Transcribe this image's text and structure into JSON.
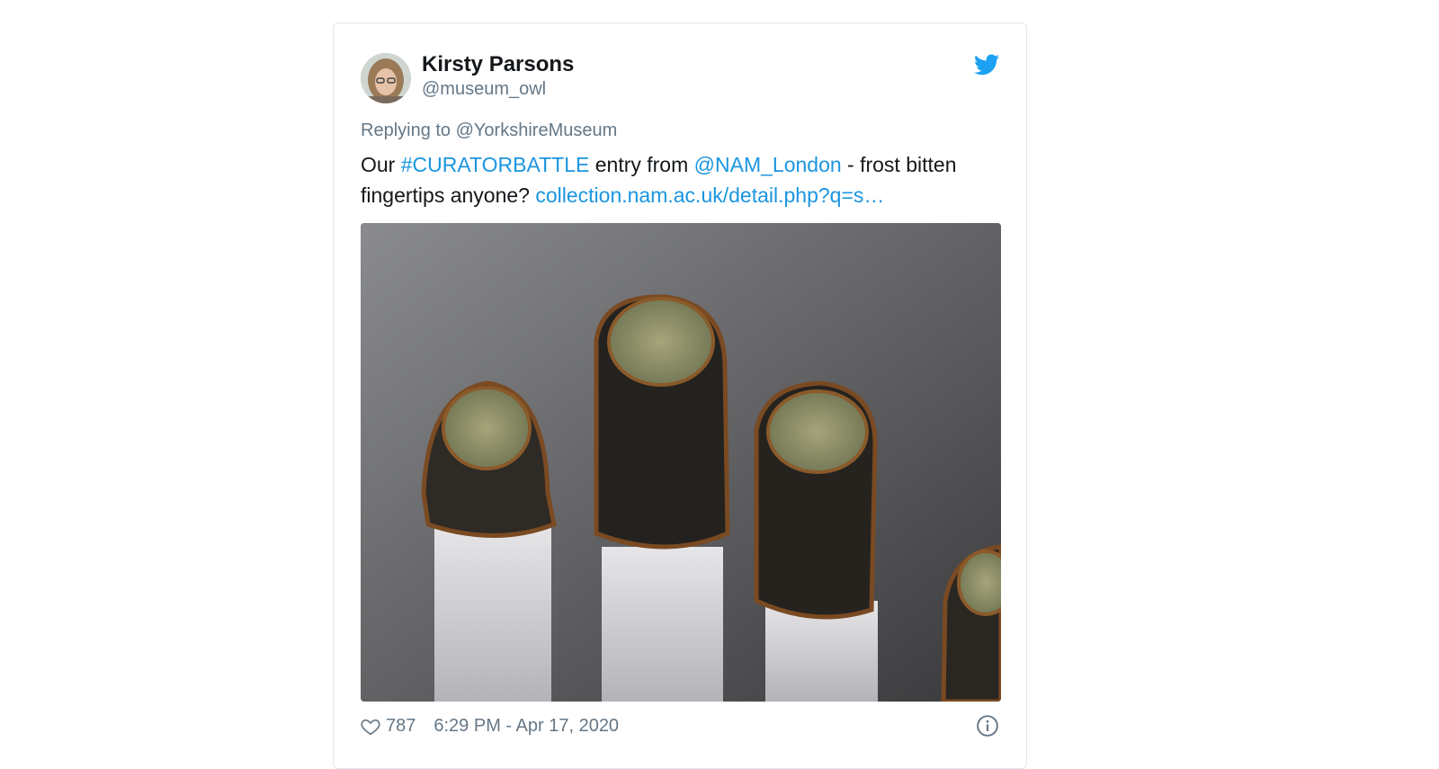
{
  "tweet": {
    "author_name": "Kirsty Parsons",
    "author_handle": "@museum_owl",
    "reply_prefix": "Replying to",
    "reply_to": "@YorkshireMuseum",
    "text_1": "Our ",
    "hashtag": "#CURATORBATTLE",
    "text_2": " entry from ",
    "mention": "@NAM_London",
    "text_3": " - frost bitten fingertips anyone? ",
    "url": "collection.nam.ac.uk/detail.php?q=s…",
    "likes": "787",
    "timestamp": "6:29 PM - Apr 17, 2020"
  },
  "icons": {
    "logo": "twitter-bird-icon",
    "like": "heart-icon",
    "info": "info-icon"
  },
  "colors": {
    "link": "#1b95e0",
    "twitter_blue": "#1da1f2",
    "muted": "#657786"
  }
}
